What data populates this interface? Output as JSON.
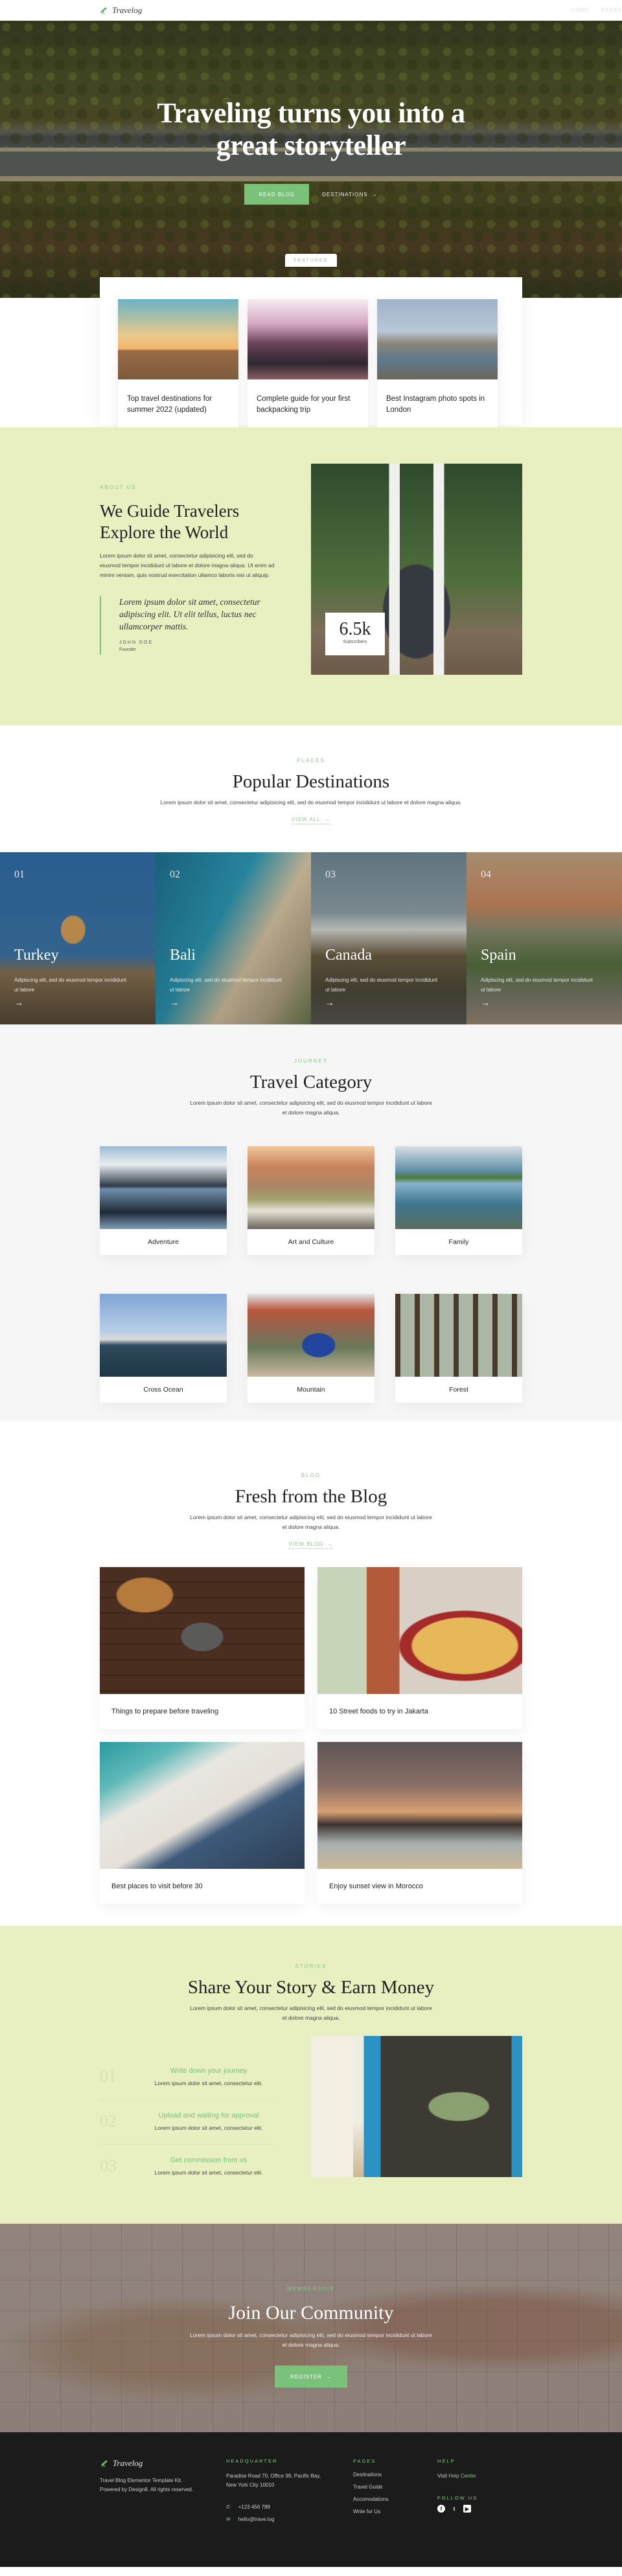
{
  "header": {
    "logo": "Travelog",
    "nav": [
      "HOME",
      "PAGES"
    ]
  },
  "hero": {
    "title_line1": "Traveling turns you into a",
    "title_line2": "great storyteller",
    "primary_button": "READ BLOG",
    "secondary_button": "DESTINATIONS",
    "arrow": "→"
  },
  "featured": {
    "label": "FEATURED",
    "cards": [
      {
        "title": "Top travel destinations for summer 2022 (updated)"
      },
      {
        "title": "Complete guide for your first backpacking trip"
      },
      {
        "title": "Best Instagram photo spots in London"
      }
    ]
  },
  "about": {
    "kicker": "ABOUT US",
    "title_line1": "We Guide Travelers",
    "title_line2": "Explore the World",
    "body": "Lorem ipsum dolor sit amet, consectetur adipisicing elit, sed do eiusmod tempor incididunt ut labore et dolore magna aliqua. Ut enim ad minim veniam, quis nostrud exercitation ullamco laboris nisi ut aliquip.",
    "quote": "Lorem ipsum dolor sit amet, consectetur adipiscing elit. Ut elit tellus, luctus nec ullamcorper mattis.",
    "author": "JOHN DOE",
    "role": "Founder",
    "stat_value": "6.5k",
    "stat_label": "Subscribers"
  },
  "places": {
    "kicker": "PLACES",
    "title": "Popular Destinations",
    "subtitle": "Lorem ipsum dolor sit amet, consectetur adipisicing elit, sed do eiusmod tempor incididunt ut labore et dolore magna aliqua.",
    "view_all": "VIEW ALL",
    "arrow": "→",
    "items": [
      {
        "num": "01",
        "name": "Turkey",
        "desc": "Adipiscing elit, sed do eiusmod tempor incididunt ut labore",
        "arrow": "→"
      },
      {
        "num": "02",
        "name": "Bali",
        "desc": "Adipiscing elit, sed do eiusmod tempor incididunt ut labore",
        "arrow": "→"
      },
      {
        "num": "03",
        "name": "Canada",
        "desc": "Adipiscing elit, sed do eiusmod tempor incididunt ut labore",
        "arrow": "→"
      },
      {
        "num": "04",
        "name": "Spain",
        "desc": "Adipiscing elit, sed do eiusmod tempor incididunt ut labore",
        "arrow": "→"
      }
    ]
  },
  "category": {
    "kicker": "JOURNEY",
    "title": "Travel Category",
    "subtitle": "Lorem ipsum dolor sit amet, consectetur adipisicing elit, sed do eiusmod tempor incididunt ut labore et dolore magna aliqua.",
    "items": [
      "Adventure",
      "Art and Culture",
      "Family",
      "Cross Ocean",
      "Mountain",
      "Forest"
    ]
  },
  "blog": {
    "kicker": "BLOG",
    "title": "Fresh from the Blog",
    "subtitle": "Lorem ipsum dolor sit amet, consectetur adipisicing elit, sed do eiusmod tempor incididunt ut labore et dolore magna aliqua.",
    "view_blog": "VIEW BLOG",
    "arrow": "→",
    "posts": [
      "Things to prepare before traveling",
      "10 Street foods to try in Jakarta",
      "Best places to visit before 30",
      "Enjoy sunset view in Morocco"
    ]
  },
  "stories": {
    "kicker": "STORIES",
    "title": "Share Your Story & Earn Money",
    "subtitle": "Lorem ipsum dolor sit amet, consectetur adipisicing elit, sed do eiusmod tempor incididunt ut labore et dolore magna aliqua.",
    "steps": [
      {
        "num": "01",
        "title": "Write down your journey",
        "desc": "Lorem ipsum dolor sit amet, consectetur elit."
      },
      {
        "num": "02",
        "title": "Upload and waiting for approval",
        "desc": "Lorem ipsum dolor sit amet, consectetur elit."
      },
      {
        "num": "03",
        "title": "Get commission from us",
        "desc": "Lorem ipsum dolor sit amet, consectetur elit."
      }
    ]
  },
  "community": {
    "kicker": "MEMBERSHIP",
    "title": "Join Our Community",
    "subtitle": "Lorem ipsum dolor sit amet, consectetur adipisicing elit, sed do eiusmod tempor incididunt ut labore et dolore magna aliqua.",
    "button": "REGISTER",
    "arrow": "→"
  },
  "footer": {
    "logo": "Travelog",
    "about": "Travel Blog Elementor Template Kit. Powered by Design8. All rights reserved.",
    "hq_heading": "HEADQUARTER",
    "address": "Paradise Road 70, Office 99, Pacific Bay,  New York City 10010",
    "phone": "+123 456 789",
    "email": "hello@trave.log",
    "pages_heading": "PAGES",
    "pages": [
      "Destinations",
      "Travel Guide",
      "Accomodations",
      "Write for Us"
    ],
    "help_heading": "HELP",
    "help_prefix": "Visit",
    "help_link": "Help Center",
    "follow_heading": "FOLLOW US",
    "social": [
      {
        "icon": "facebook-icon",
        "glyph": "f"
      },
      {
        "icon": "twitter-icon",
        "glyph": "t"
      },
      {
        "icon": "youtube-icon",
        "glyph": "▶"
      }
    ]
  },
  "colors": {
    "accent": "#7ac17a",
    "soft_green_bg": "#e8efc0",
    "footer_bg": "#1b1b1b",
    "light_bg": "#f6f6f6"
  }
}
